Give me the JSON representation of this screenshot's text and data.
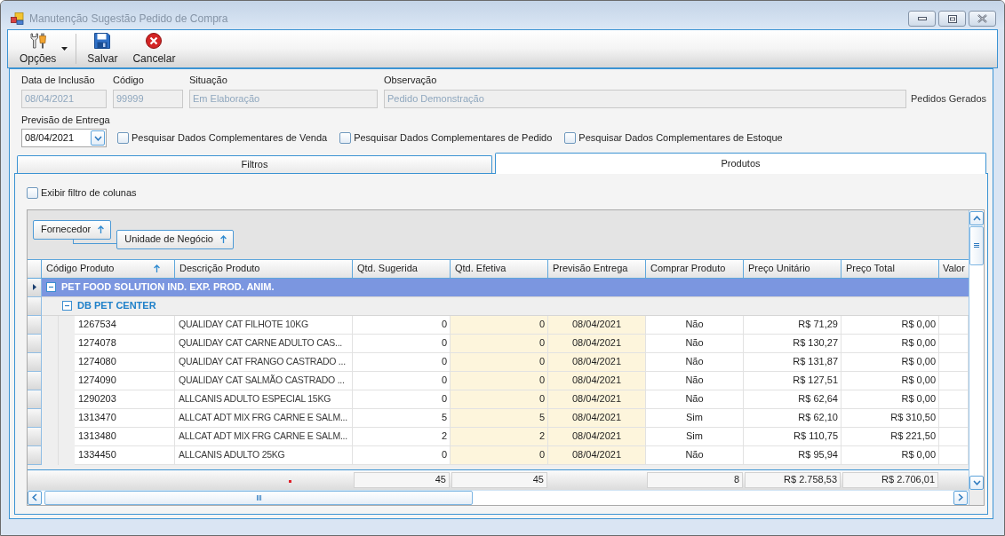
{
  "window": {
    "title": "Manutenção Sugestão Pedido de Compra"
  },
  "toolbar": [
    {
      "label": "Opções",
      "kind": "dropdown"
    },
    {
      "label": "Salvar",
      "kind": "button"
    },
    {
      "label": "Cancelar",
      "kind": "button"
    }
  ],
  "form": {
    "fields": [
      {
        "label": "Data de Inclusão",
        "value": "08/04/2021",
        "disabled": true
      },
      {
        "label": "Código",
        "value": "99999",
        "disabled": true
      },
      {
        "label": "Situação",
        "value": "Em Elaboração",
        "disabled": true
      },
      {
        "label": "Observação",
        "value": "Pedido Demonstração",
        "disabled": true
      }
    ],
    "side_label": "Pedidos Gerados",
    "delivery": {
      "label": "Previsão de Entrega",
      "value": "08/04/2021"
    },
    "search_options": [
      {
        "label": "Pesquisar Dados Complementares de Venda",
        "checked": false
      },
      {
        "label": "Pesquisar Dados Complementares de Pedido",
        "checked": false
      },
      {
        "label": "Pesquisar Dados Complementares de Estoque",
        "checked": false
      }
    ]
  },
  "tabs": [
    {
      "label": "Filtros",
      "selected": false
    },
    {
      "label": "Produtos",
      "selected": true
    }
  ],
  "column_filter": {
    "label": "Exibir filtro de colunas",
    "checked": false
  },
  "grid": {
    "group_by": [
      {
        "label": "Fornecedor"
      },
      {
        "label": "Unidade de Negócio"
      }
    ],
    "columns": [
      {
        "label": "Código Produto",
        "kind": "text",
        "sorted": true,
        "editable": false
      },
      {
        "label": "Descrição Produto",
        "kind": "text",
        "sorted": false,
        "editable": false
      },
      {
        "label": "Qtd. Sugerida",
        "kind": "number",
        "sorted": false,
        "editable": false,
        "total": "45"
      },
      {
        "label": "Qtd. Efetiva",
        "kind": "number",
        "sorted": false,
        "editable": true,
        "total": "45"
      },
      {
        "label": "Previsão Entrega",
        "kind": "date",
        "sorted": false,
        "editable": true
      },
      {
        "label": "Comprar Produto",
        "kind": "choice",
        "sorted": false,
        "editable": false,
        "total": "8"
      },
      {
        "label": "Preço Unitário",
        "kind": "currency",
        "sorted": false,
        "editable": false,
        "total": "R$ 2.758,53"
      },
      {
        "label": "Preço Total",
        "kind": "currency",
        "sorted": false,
        "editable": false,
        "total": "R$ 2.706,01"
      },
      {
        "label": "Valor",
        "sorted": false,
        "editable": false
      }
    ],
    "groups": [
      {
        "label": "PET FOOD SOLUTION IND. EXP. PROD. ANIM.",
        "expanded": true,
        "selected": true,
        "children": [
          {
            "label": "DB PET CENTER",
            "expanded": true,
            "selected": false,
            "rows": [
              {
                "cells": [
                  "1267534",
                  "QUALIDAY CAT FILHOTE 10KG",
                  "0",
                  "0",
                  "08/04/2021",
                  "Não",
                  "R$ 71,29",
                  "R$ 0,00"
                ],
                "selected": false
              },
              {
                "cells": [
                  "1274078",
                  "QUALIDAY CAT CARNE ADULTO CAS...",
                  "0",
                  "0",
                  "08/04/2021",
                  "Não",
                  "R$ 130,27",
                  "R$ 0,00"
                ],
                "selected": false
              },
              {
                "cells": [
                  "1274080",
                  "QUALIDAY CAT FRANGO CASTRADO ...",
                  "0",
                  "0",
                  "08/04/2021",
                  "Não",
                  "R$ 131,87",
                  "R$ 0,00"
                ],
                "selected": false
              },
              {
                "cells": [
                  "1274090",
                  "QUALIDAY CAT SALMÃO CASTRADO ...",
                  "0",
                  "0",
                  "08/04/2021",
                  "Não",
                  "R$ 127,51",
                  "R$ 0,00"
                ],
                "selected": false
              },
              {
                "cells": [
                  "1290203",
                  "ALLCANIS ADULTO ESPECIAL 15KG",
                  "0",
                  "0",
                  "08/04/2021",
                  "Não",
                  "R$ 62,64",
                  "R$ 0,00"
                ],
                "selected": false
              },
              {
                "cells": [
                  "1313470",
                  "ALLCAT ADT MIX FRG CARNE E SALM...",
                  "5",
                  "5",
                  "08/04/2021",
                  "Sim",
                  "R$ 62,10",
                  "R$ 310,50"
                ],
                "selected": false
              },
              {
                "cells": [
                  "1313480",
                  "ALLCAT ADT MIX FRG CARNE E SALM...",
                  "2",
                  "2",
                  "08/04/2021",
                  "Sim",
                  "R$ 110,75",
                  "R$ 221,50"
                ],
                "selected": false
              },
              {
                "cells": [
                  "1334450",
                  "ALLCANIS ADULTO 25KG",
                  "0",
                  "0",
                  "08/04/2021",
                  "Não",
                  "R$ 95,94",
                  "R$ 0,00"
                ],
                "selected": false
              }
            ]
          }
        ]
      }
    ]
  }
}
